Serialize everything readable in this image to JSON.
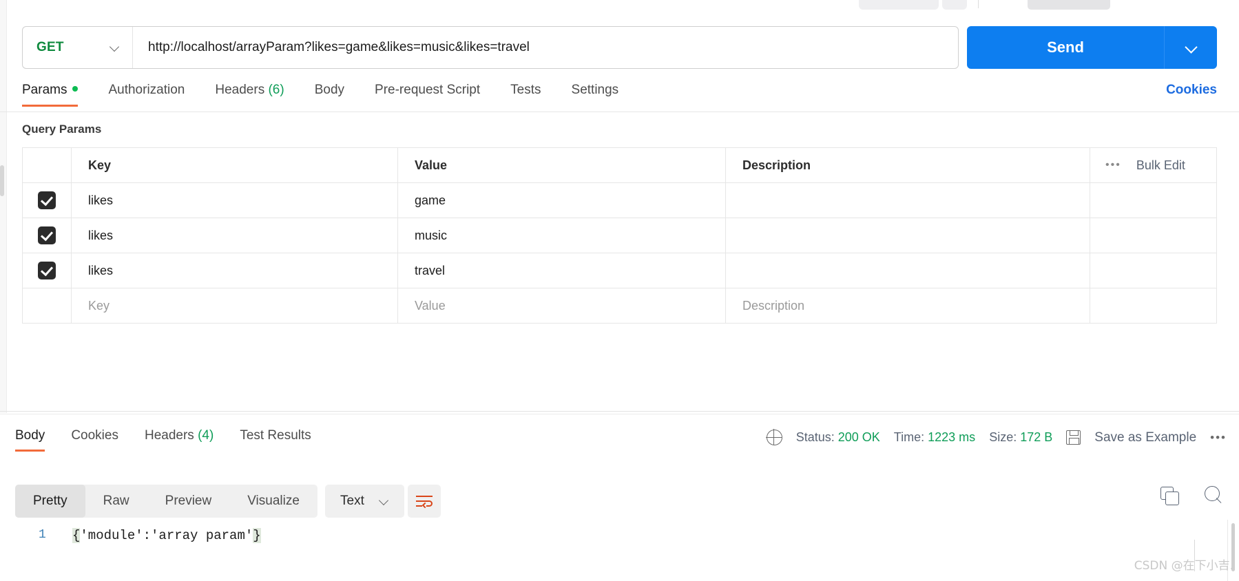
{
  "request": {
    "method": "GET",
    "method_color": "#0f8a3e",
    "url": "http://localhost/arrayParam?likes=game&likes=music&likes=travel",
    "send_label": "Send",
    "send_color": "#0d7ef0",
    "method_dropdown_icon": "chevron-down-icon",
    "send_dropdown_icon": "chevron-down-icon"
  },
  "request_tabs": {
    "items": [
      {
        "label": "Params",
        "active": true,
        "dot": true
      },
      {
        "label": "Authorization",
        "active": false
      },
      {
        "label": "Headers",
        "count": "(6)",
        "active": false
      },
      {
        "label": "Body",
        "active": false
      },
      {
        "label": "Pre-request Script",
        "active": false
      },
      {
        "label": "Tests",
        "active": false
      },
      {
        "label": "Settings",
        "active": false
      }
    ],
    "cookies_link": "Cookies",
    "active_underline_color": "#f26b3a",
    "dot_color": "#0cbb52"
  },
  "query_params": {
    "section_title": "Query Params",
    "columns": [
      "Key",
      "Value",
      "Description"
    ],
    "bulk_edit_label": "Bulk Edit",
    "bulk_more_icon": "more-horizontal-icon",
    "rows": [
      {
        "checked": true,
        "key": "likes",
        "value": "game",
        "description": ""
      },
      {
        "checked": true,
        "key": "likes",
        "value": "music",
        "description": ""
      },
      {
        "checked": true,
        "key": "likes",
        "value": "travel",
        "description": ""
      }
    ],
    "placeholder_row": {
      "key": "Key",
      "value": "Value",
      "description": "Description"
    }
  },
  "response": {
    "tabs": [
      {
        "label": "Body",
        "active": true
      },
      {
        "label": "Cookies",
        "active": false
      },
      {
        "label": "Headers",
        "count": "(4)",
        "active": false
      },
      {
        "label": "Test Results",
        "active": false
      }
    ],
    "network_icon": "globe-icon",
    "status_label": "Status:",
    "status_value": "200 OK",
    "time_label": "Time:",
    "time_value": "1223 ms",
    "size_label": "Size:",
    "size_value": "172 B",
    "value_color": "#0f9d58",
    "save_icon": "floppy-disk-icon",
    "save_as_example": "Save as Example",
    "more_icon": "more-horizontal-icon"
  },
  "body_toolbar": {
    "formats": [
      {
        "label": "Pretty",
        "active": true
      },
      {
        "label": "Raw",
        "active": false
      },
      {
        "label": "Preview",
        "active": false
      },
      {
        "label": "Visualize",
        "active": false
      }
    ],
    "content_type": "Text",
    "content_type_icon": "chevron-down-icon",
    "wrap_icon": "word-wrap-icon",
    "wrap_icon_color": "#d9461a",
    "copy_icon": "copy-icon",
    "search_icon": "search-icon"
  },
  "body_content": {
    "line_numbers": [
      "1"
    ],
    "line_prefix": "{",
    "line_middle": "'module':'array param'",
    "line_suffix": "}"
  },
  "watermark": "CSDN @在下小吉."
}
